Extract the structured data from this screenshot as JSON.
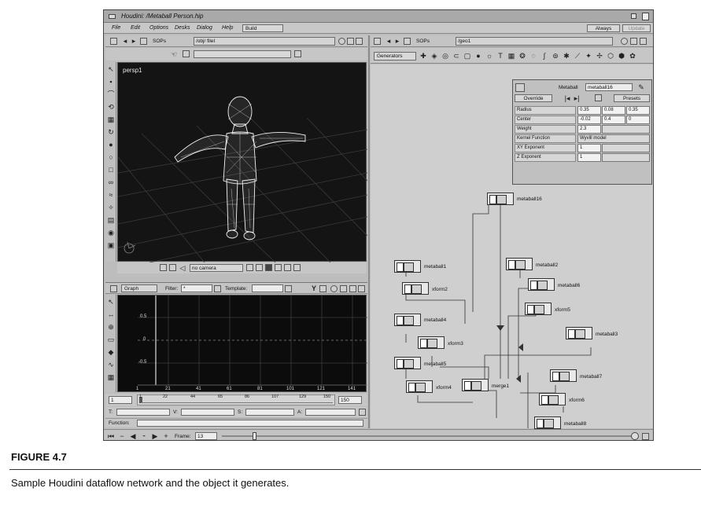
{
  "window": {
    "title": "Houdini: /Metaball Person.hip"
  },
  "menu": {
    "items": [
      "File",
      "Edit",
      "Options",
      "Desks",
      "Dialog",
      "Help"
    ],
    "build_label": "Build"
  },
  "update": {
    "mode_label": "Always",
    "update_label": "Update"
  },
  "viewer": {
    "pane_type": "SOPs",
    "path": "/obj/ fileI",
    "viewport_label": "persp1",
    "camera_label": "no camera"
  },
  "network": {
    "pane_type": "SOPs",
    "path": "/geo1",
    "operator_menu": "Generators"
  },
  "parameters": {
    "type_label": "Metaball",
    "node_name": "metaball16",
    "override_label": "Override",
    "presets_label": "Presets",
    "rows": [
      {
        "label": "Radius",
        "values": [
          "0.35",
          "0.08",
          "0.35"
        ]
      },
      {
        "label": "Center",
        "values": [
          "-0.02",
          "0.4",
          "0"
        ]
      },
      {
        "label": "Weight",
        "values": [
          "2.3"
        ]
      },
      {
        "label": "Kernel Function",
        "values": [
          "Wyvill model"
        ]
      },
      {
        "label": "XY Exponent",
        "values": [
          "1"
        ]
      },
      {
        "label": "Z Exponent",
        "values": [
          "1"
        ]
      }
    ]
  },
  "nodes": [
    {
      "name": "metaball16"
    },
    {
      "name": "metaball1"
    },
    {
      "name": "xform2"
    },
    {
      "name": "metaball2"
    },
    {
      "name": "metaball6"
    },
    {
      "name": "xform5"
    },
    {
      "name": "metaball4"
    },
    {
      "name": "xform3"
    },
    {
      "name": "metaball3"
    },
    {
      "name": "metaball5"
    },
    {
      "name": "xform4"
    },
    {
      "name": "merge1"
    },
    {
      "name": "metaball7"
    },
    {
      "name": "xform6"
    },
    {
      "name": "metaball8"
    }
  ],
  "graph": {
    "type_label": "Graph",
    "filter_label": "Filter:",
    "filter_value": "*",
    "template_label": "Template:",
    "y_labels": [
      "0.5",
      "0",
      "-0.5"
    ],
    "x_ticks": [
      "1",
      "21",
      "41",
      "61",
      "81",
      "101",
      "121",
      "141"
    ],
    "range_ticks": [
      "1",
      "22",
      "44",
      "65",
      "86",
      "107",
      "129",
      "150"
    ],
    "range_start": "1",
    "range_end": "150",
    "fields": [
      "T:",
      "V:",
      "S:",
      "A:"
    ],
    "function_label": "Function:"
  },
  "playbar": {
    "frame_label": "Frame:",
    "frame_value": "13"
  },
  "caption": {
    "title": "FIGURE 4.7",
    "text": "Sample Houdini dataflow network and the object it generates."
  }
}
